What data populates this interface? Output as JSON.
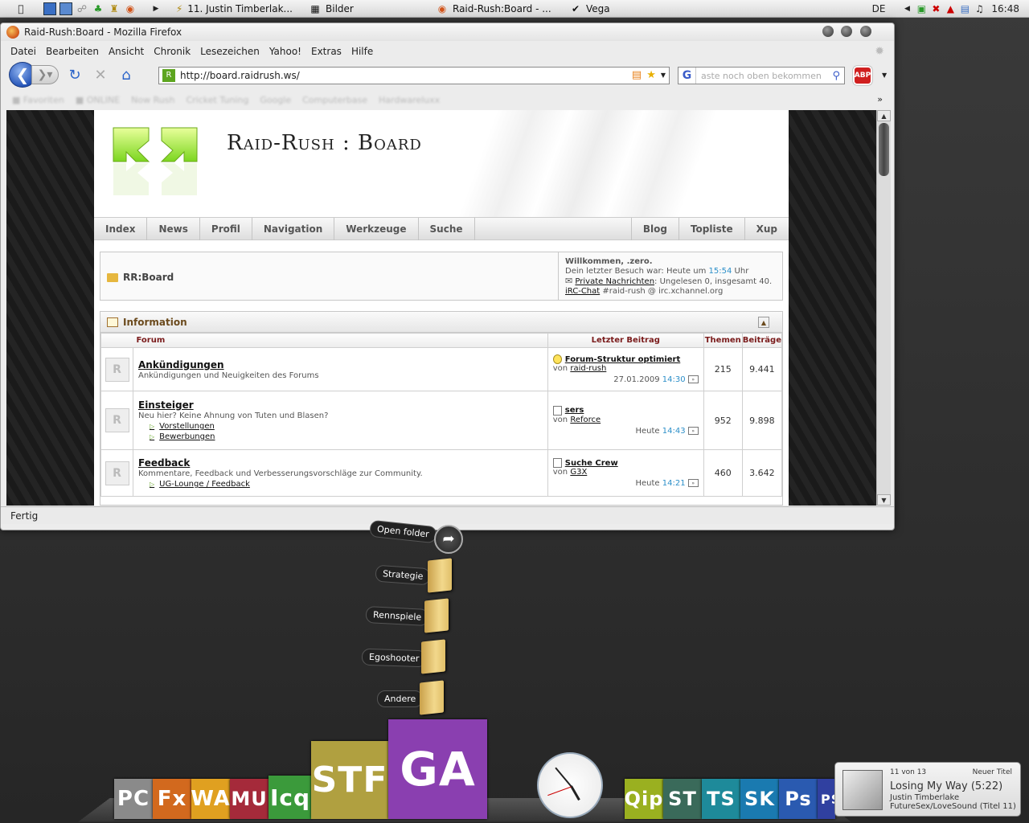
{
  "taskbar": {
    "tasks": [
      {
        "label": "11. Justin Timberlak...",
        "icon": "winamp-icon"
      },
      {
        "label": "Bilder",
        "icon": "folder-icon"
      },
      {
        "label": "Raid-Rush:Board - ...",
        "icon": "firefox-icon"
      },
      {
        "label": "Vega",
        "icon": "vega-icon"
      }
    ],
    "lang": "DE",
    "clock": "16:48"
  },
  "firefox": {
    "window_title": "Raid-Rush:Board - Mozilla Firefox",
    "menu": [
      "Datei",
      "Bearbeiten",
      "Ansicht",
      "Chronik",
      "Lesezeichen",
      "Yahoo!",
      "Extras",
      "Hilfe"
    ],
    "url": "http://board.raidrush.ws/",
    "search_value": "aste noch oben bekommen",
    "abp_label": "ABP",
    "status": "Fertig"
  },
  "page": {
    "site_title": "Raid-Rush : Board",
    "nav_left": [
      "Index",
      "News",
      "Profil",
      "Navigation",
      "Werkzeuge",
      "Suche"
    ],
    "nav_right": [
      "Blog",
      "Topliste",
      "Xup"
    ],
    "breadcrumb": "RR:Board",
    "welcome": {
      "line1": "Willkommen, .zero.",
      "line2_prefix": "Dein letzter Besuch war: Heute um",
      "line2_time": "15:54",
      "line2_suffix": "Uhr",
      "pm_link": "Private Nachrichten",
      "pm_text": ": Ungelesen 0, insgesamt 40.",
      "irc_link": "iRC-Chat",
      "irc_text": "#raid-rush @ irc.xchannel.org"
    },
    "section_title": "Information",
    "columns": {
      "forum": "Forum",
      "last": "Letzter Beitrag",
      "topics": "Themen",
      "posts": "Beiträge"
    },
    "forums": [
      {
        "name": "Ankündigungen",
        "desc": "Ankündigungen und Neuigkeiten des Forums",
        "subs": [],
        "last_title": "Forum-Struktur optimiert",
        "last_by_prefix": "von",
        "last_by": "raid-rush",
        "last_date": "27.01.2009",
        "last_time": "14:30",
        "topics": "215",
        "posts": "9.441"
      },
      {
        "name": "Einsteiger",
        "desc": "Neu hier? Keine Ahnung von Tuten und Blasen?",
        "subs": [
          "Vorstellungen",
          "Bewerbungen"
        ],
        "last_title": "sers",
        "last_by_prefix": "von",
        "last_by": "Reforce",
        "last_date": "Heute",
        "last_time": "14:43",
        "topics": "952",
        "posts": "9.898"
      },
      {
        "name": "Feedback",
        "desc": "Kommentare, Feedback und Verbesserungsvorschläge zur Community.",
        "subs": [
          "UG-Lounge / Feedback"
        ],
        "last_title": "Suche Crew",
        "last_by_prefix": "von",
        "last_by": "G3X",
        "last_date": "Heute",
        "last_time": "14:21",
        "topics": "460",
        "posts": "3.642"
      }
    ]
  },
  "stack": {
    "open_label": "Open folder",
    "folders": [
      "Strategie",
      "Rennspiele",
      "Egoshooter",
      "Andere"
    ]
  },
  "dock": {
    "left": [
      {
        "label": "PC",
        "color": "#8a8a8a"
      },
      {
        "label": "Fx",
        "color": "#d2691e"
      },
      {
        "label": "WA",
        "color": "#e0a020"
      },
      {
        "label": "MU",
        "color": "#a52a3a"
      },
      {
        "label": "Icq",
        "color": "#3b9a3b"
      },
      {
        "label": "STF",
        "color": "#b0a040"
      },
      {
        "label": "GA",
        "color": "#8a3fb0"
      }
    ],
    "right": [
      {
        "label": "Qip",
        "color": "#9ab020"
      },
      {
        "label": "ST",
        "color": "#3a6a5a"
      },
      {
        "label": "TS",
        "color": "#1e8a9a"
      },
      {
        "label": "SK",
        "color": "#1a7ab0"
      },
      {
        "label": "Ps",
        "color": "#2a5ab0"
      },
      {
        "label": "PS",
        "color": "#3040a0"
      }
    ]
  },
  "music": {
    "counter": "11 von 13",
    "new_title": "Neuer Titel",
    "song": "Losing My Way (5:22)",
    "artist": "Justin Timberlake",
    "album": "FutureSex/LoveSound (Titel 11)"
  }
}
